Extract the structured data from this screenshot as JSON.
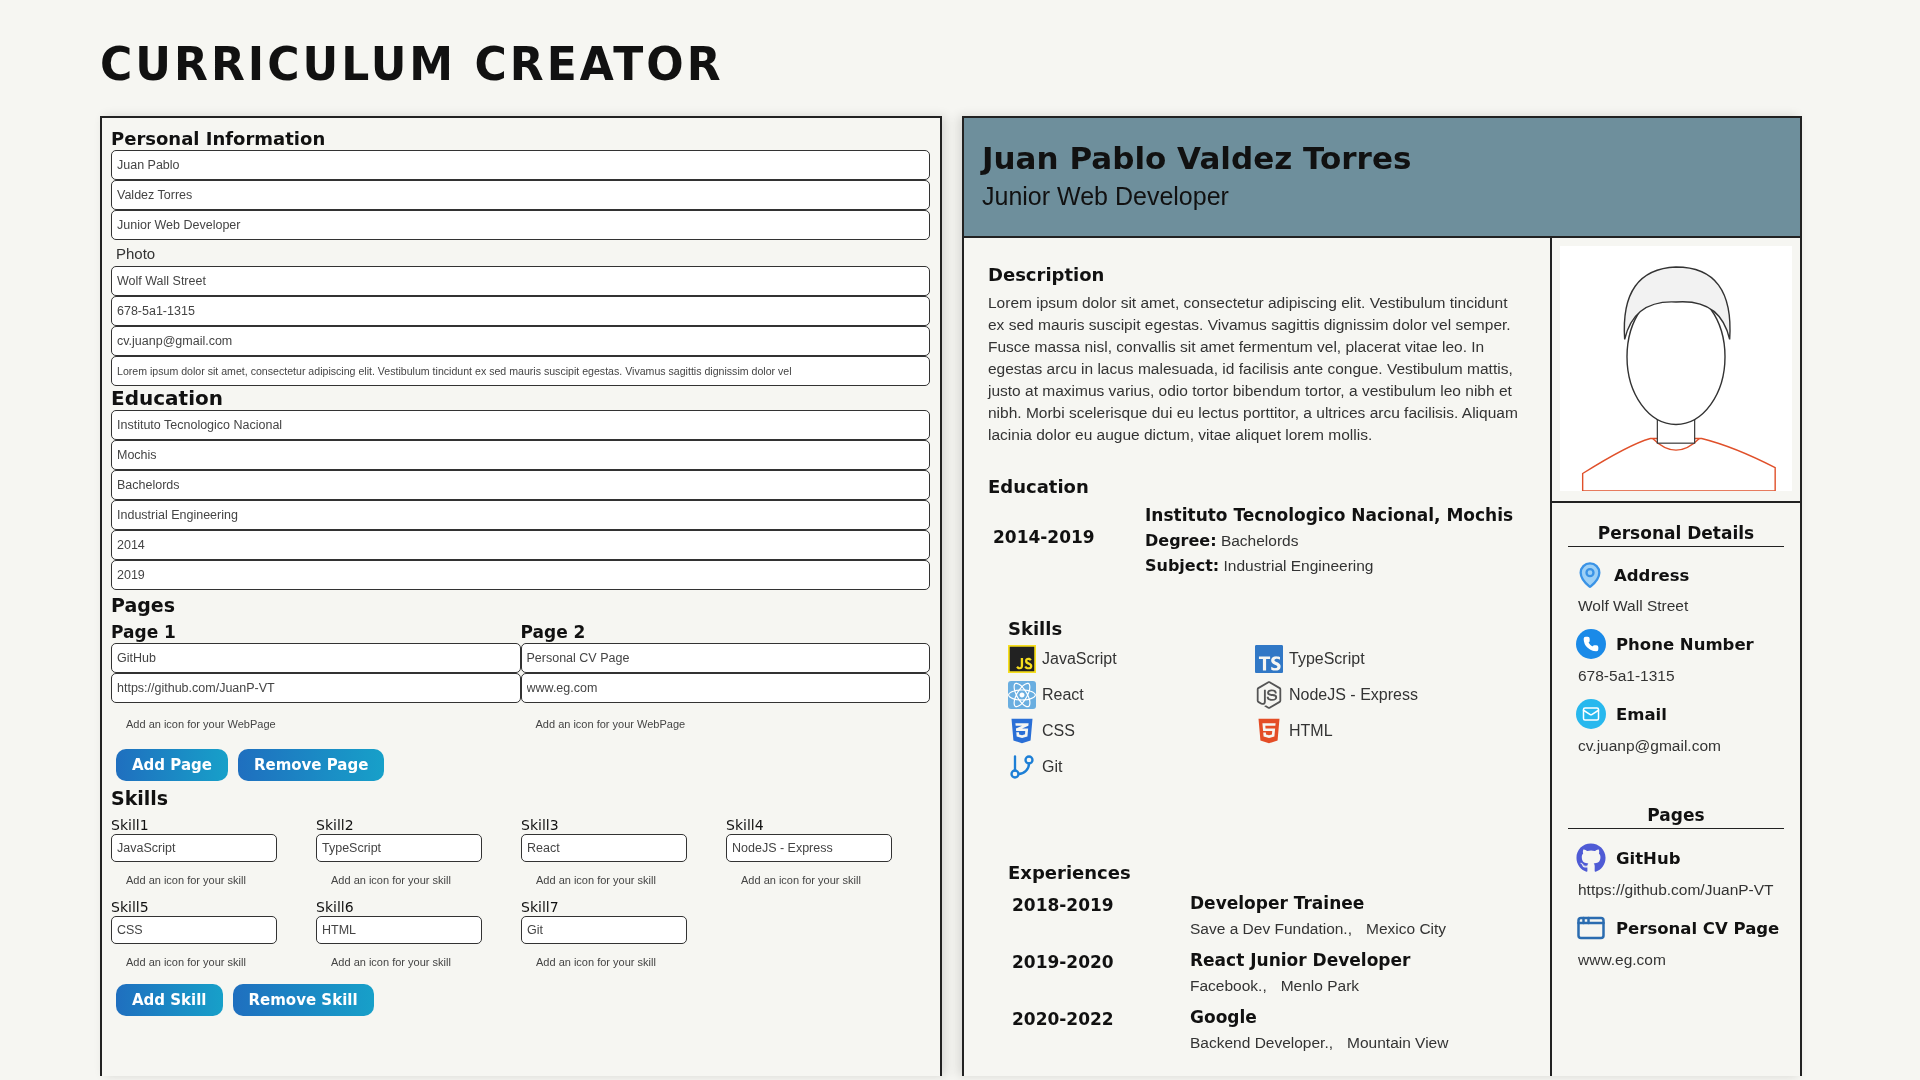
{
  "app_title": "CURRICULUM CREATOR",
  "form": {
    "personal": {
      "heading": "Personal Information",
      "fields": [
        {
          "kind": "input",
          "value": "Juan Pablo"
        },
        {
          "kind": "input",
          "value": "Valdez Torres"
        },
        {
          "kind": "input",
          "value": "Junior Web Developer"
        },
        {
          "kind": "label",
          "text": "Photo"
        },
        {
          "kind": "input",
          "value": "Wolf Wall Street"
        },
        {
          "kind": "input",
          "value": "678-5a1-1315"
        },
        {
          "kind": "input",
          "value": "cv.juanp@gmail.com"
        },
        {
          "kind": "long",
          "value": "Lorem ipsum dolor sit amet, consectetur adipiscing elit. Vestibulum tincidunt ex sed mauris suscipit egestas. Vivamus sagittis dignissim dolor vel"
        }
      ]
    },
    "education": {
      "heading": "Education",
      "fields": [
        "Instituto Tecnologico Nacional",
        "Mochis",
        "Bachelords",
        "Industrial Engineering",
        "2014",
        "2019"
      ]
    },
    "pages": {
      "heading": "Pages",
      "items": [
        {
          "title": "Page 1",
          "name": "GitHub",
          "url": "https://github.com/JuanP-VT",
          "hint": "Add an icon for your WebPage"
        },
        {
          "title": "Page 2",
          "name": "Personal CV Page",
          "url": "www.eg.com",
          "hint": "Add an icon for your WebPage"
        }
      ],
      "buttons": [
        "Add Page",
        "Remove Page"
      ]
    },
    "skills": {
      "heading": "Skills",
      "items": [
        {
          "label": "Skill1",
          "value": "JavaScript",
          "hint": "Add an icon for your skill"
        },
        {
          "label": "Skill2",
          "value": "TypeScript",
          "hint": "Add an icon for your skill"
        },
        {
          "label": "Skill3",
          "value": "React",
          "hint": "Add an icon for your skill"
        },
        {
          "label": "Skill4",
          "value": "NodeJS - Express",
          "hint": "Add an icon for your skill"
        },
        {
          "label": "Skill5",
          "value": "CSS",
          "hint": "Add an icon for your skill"
        },
        {
          "label": "Skill6",
          "value": "HTML",
          "hint": "Add an icon for your skill"
        },
        {
          "label": "Skill7",
          "value": "Git",
          "hint": "Add an icon for your skill"
        }
      ],
      "buttons": [
        "Add Skill",
        "Remove Skill"
      ]
    }
  },
  "cv": {
    "name": "Juan Pablo Valdez Torres",
    "role": "Junior Web Developer",
    "description": {
      "heading": "Description",
      "text": "Lorem ipsum dolor sit amet, consectetur adipiscing elit. Vestibulum tincidunt ex sed mauris suscipit egestas. Vivamus sagittis dignissim dolor vel semper. Fusce massa nisl, convallis sit amet fermentum vel, placerat vitae leo. In egestas arcu in lacus malesuada, id facilisis ante congue. Vestibulum mattis, justo at maximus varius, odio tortor bibendum tortor, a vestibulum leo nibh et nibh. Morbi scelerisque dui eu lectus porttitor, a ultrices arcu facilisis. Aliquam lacinia dolor eu augue dictum, vitae aliquet lorem mollis."
    },
    "education": {
      "heading": "Education",
      "entries": [
        {
          "years": "2014-2019",
          "school": "Instituto Tecnologico Nacional, Mochis",
          "degree_label": "Degree:",
          "degree": "Bachelords",
          "subject_label": "Subject:",
          "subject": "Industrial Engineering"
        }
      ]
    },
    "skills": {
      "heading": "Skills",
      "items": [
        "JavaScript",
        "TypeScript",
        "React",
        "NodeJS - Express",
        "CSS",
        "HTML",
        "Git"
      ]
    },
    "experiences": {
      "heading": "Experiences",
      "items": [
        {
          "years": "2018-2019",
          "title": "Developer Trainee",
          "company": "Save a Dev Fundation.,",
          "place": "Mexico City"
        },
        {
          "years": "2019-2020",
          "title": "React Junior Developer",
          "company": "Facebook.,",
          "place": "Menlo Park"
        },
        {
          "years": "2020-2022",
          "title": "Google",
          "company": "Backend Developer.,",
          "place": "Mountain View"
        }
      ]
    },
    "personal_details": {
      "heading": "Personal Details",
      "items": [
        {
          "label": "Address",
          "value": "Wolf Wall Street"
        },
        {
          "label": "Phone Number",
          "value": "678-5a1-1315"
        },
        {
          "label": "Email",
          "value": "cv.juanp@gmail.com"
        }
      ]
    },
    "pages": {
      "heading": "Pages",
      "items": [
        {
          "name": "GitHub",
          "url": "https://github.com/JuanP-VT"
        },
        {
          "name": "Personal CV Page",
          "url": "www.eg.com"
        }
      ]
    }
  }
}
